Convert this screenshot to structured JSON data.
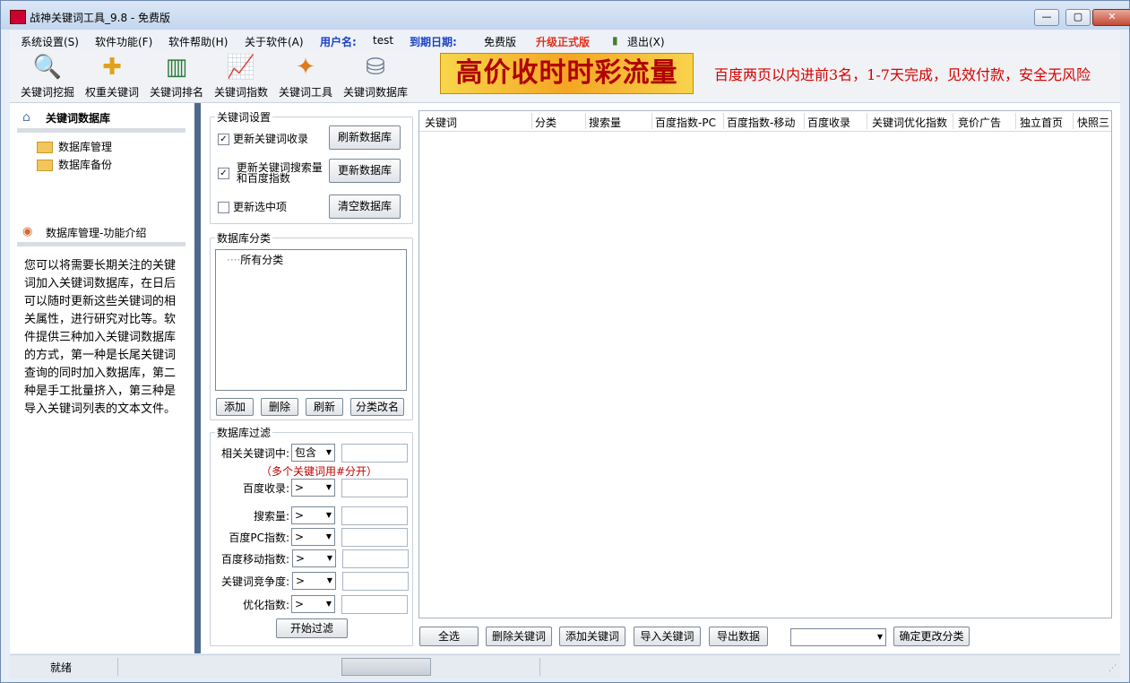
{
  "window": {
    "title": "战神关键词工具_9.8 - 免费版",
    "min": "—",
    "max": "▢",
    "close": "✕"
  },
  "menu": {
    "system": "系统设置(S)",
    "functions": "软件功能(F)",
    "help": "软件帮助(H)",
    "about": "关于软件(A)",
    "user_label": "用户名:",
    "user_value": "test",
    "expiry_label": "到期日期:",
    "expiry_value": "免费版",
    "upgrade": "升级正式版",
    "exit": "退出(X)"
  },
  "toolbar": {
    "items": [
      {
        "label": "关键词挖掘",
        "icon": "magnifier-icon"
      },
      {
        "label": "权重关键词",
        "icon": "puzzle-icon"
      },
      {
        "label": "关键词排名",
        "icon": "bar-chart-icon"
      },
      {
        "label": "关键词指数",
        "icon": "line-chart-icon"
      },
      {
        "label": "关键词工具",
        "icon": "magic-wand-icon"
      },
      {
        "label": "关键词数据库",
        "icon": "database-icon"
      }
    ],
    "banner": "高价收时时彩流量",
    "marquee": "百度两页以内进前3名，1-7天完成，见效付款，安全无风险"
  },
  "left": {
    "title": "关键词数据库",
    "tree": [
      "数据库管理",
      "数据库备份"
    ],
    "intro_title": "数据库管理-功能介绍",
    "intro_text": "您可以将需要长期关注的关键词加入关键词数据库，在日后可以随时更新这些关键词的相关属性，进行研究对比等。软件提供三种加入关键词数据库的方式，第一种是长尾关键词查询的同时加入数据库，第二种是手工批量挤入，第三种是导入关键词列表的文本文件。"
  },
  "settings": {
    "title": "关键词设置",
    "opt1": "更新关键词收录",
    "opt1_checked": "✓",
    "opt2a": "更新关键词搜索量",
    "opt2b": "和百度指数",
    "opt2_checked": "✓",
    "opt3": "更新选中项",
    "opt3_checked": "",
    "btn_refresh": "刷新数据库",
    "btn_update": "更新数据库",
    "btn_clear": "清空数据库"
  },
  "category": {
    "title": "数据库分类",
    "root": "所有分类",
    "btn_add": "添加",
    "btn_delete": "删除",
    "btn_refresh": "刷新",
    "btn_rename": "分类改名"
  },
  "filter": {
    "title": "数据库过滤",
    "rows": [
      {
        "label": "相关关键词中:",
        "op": "包含"
      },
      {
        "label": "百度收录:",
        "op": ">"
      },
      {
        "label": "搜索量:",
        "op": ">"
      },
      {
        "label": "百度PC指数:",
        "op": ">"
      },
      {
        "label": "百度移动指数:",
        "op": ">"
      },
      {
        "label": "关键词竞争度:",
        "op": ">"
      },
      {
        "label": "优化指数:",
        "op": ">"
      }
    ],
    "hint": "（多个关键词用#分开）",
    "start": "开始过滤"
  },
  "grid": {
    "columns": [
      "关键词",
      "分类",
      "搜索量",
      "百度指数-PC",
      "百度指数-移动",
      "百度收录",
      "关键词优化指数",
      "竞价广告",
      "独立首页",
      "快照三"
    ]
  },
  "actions": {
    "select_all": "全选",
    "delete_kw": "删除关键词",
    "add_kw": "添加关键词",
    "import_kw": "导入关键词",
    "export": "导出数据",
    "category_select": "",
    "confirm_category": "确定更改分类"
  },
  "status": {
    "text": "就绪"
  }
}
